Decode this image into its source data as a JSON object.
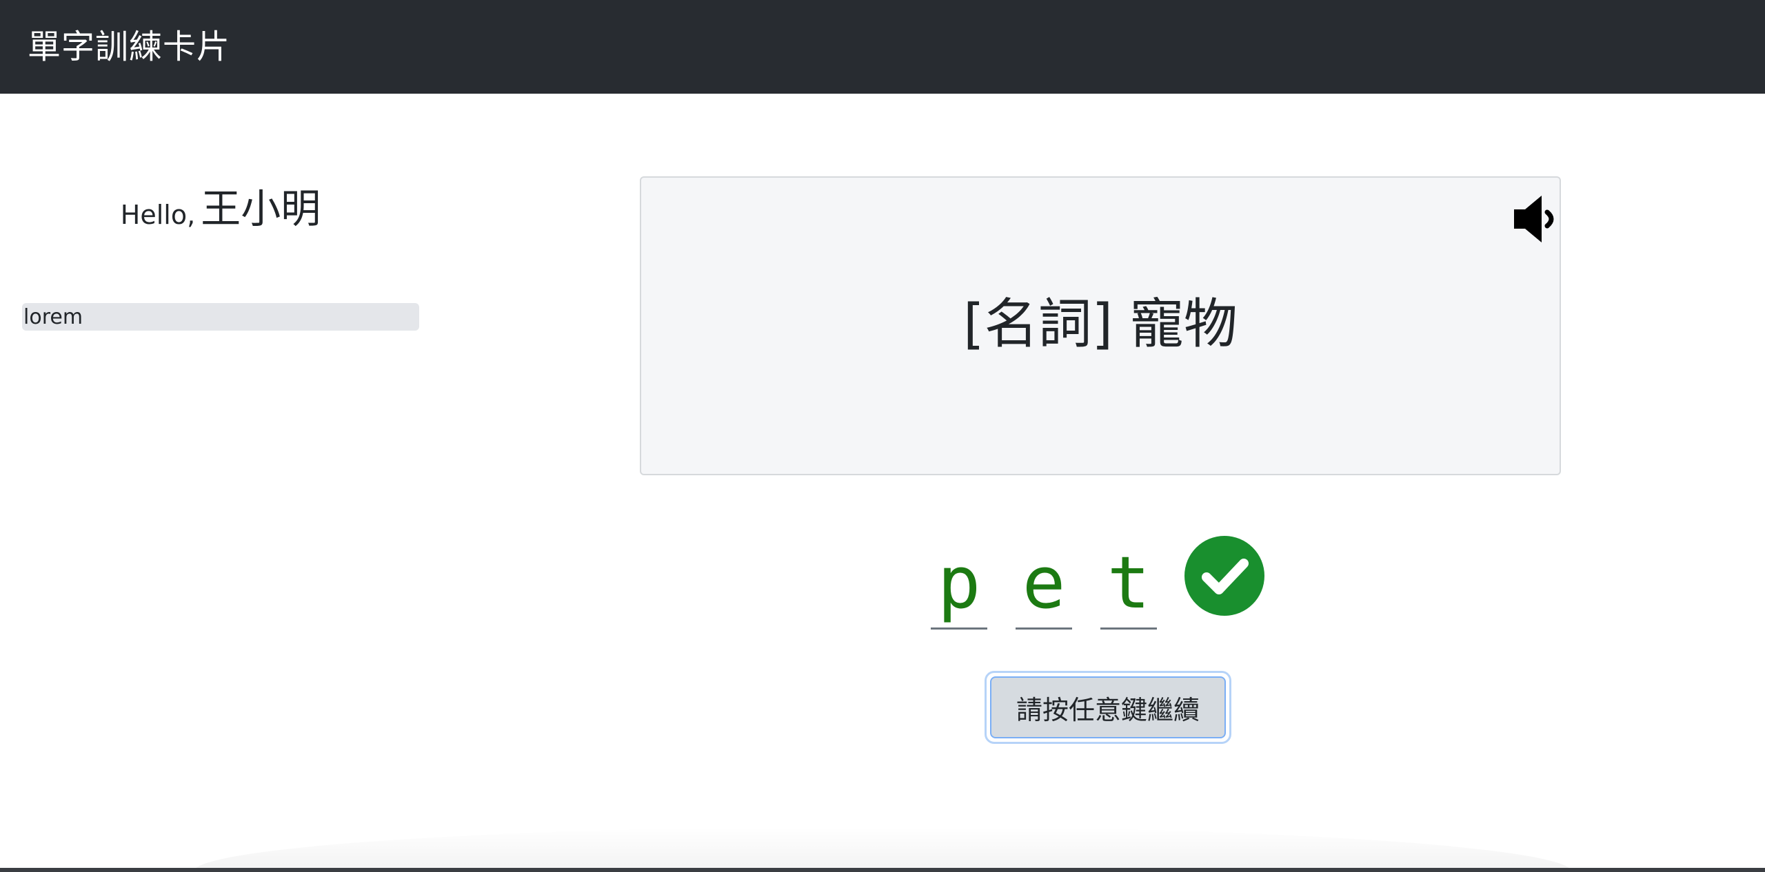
{
  "navbar": {
    "brand": "單字訓練卡片"
  },
  "sidebar": {
    "greeting_prefix": "Hello,",
    "user_name": "王小明",
    "items": [
      {
        "label": "lorem"
      }
    ]
  },
  "card": {
    "definition": "[名詞] 寵物",
    "speaker_icon": "volume-icon"
  },
  "answer": {
    "letters": [
      "p",
      "e",
      "t"
    ],
    "status": "correct",
    "status_icon": "check-circle-icon",
    "status_color": "#198f2e",
    "letter_color": "#1c7a12"
  },
  "continue_button": {
    "label": "請按任意鍵繼續"
  },
  "colors": {
    "navbar_bg": "#282c31",
    "card_bg": "#f5f6f8",
    "button_bg": "#d6dbe0",
    "focus_ring": "#b6d3f8"
  }
}
